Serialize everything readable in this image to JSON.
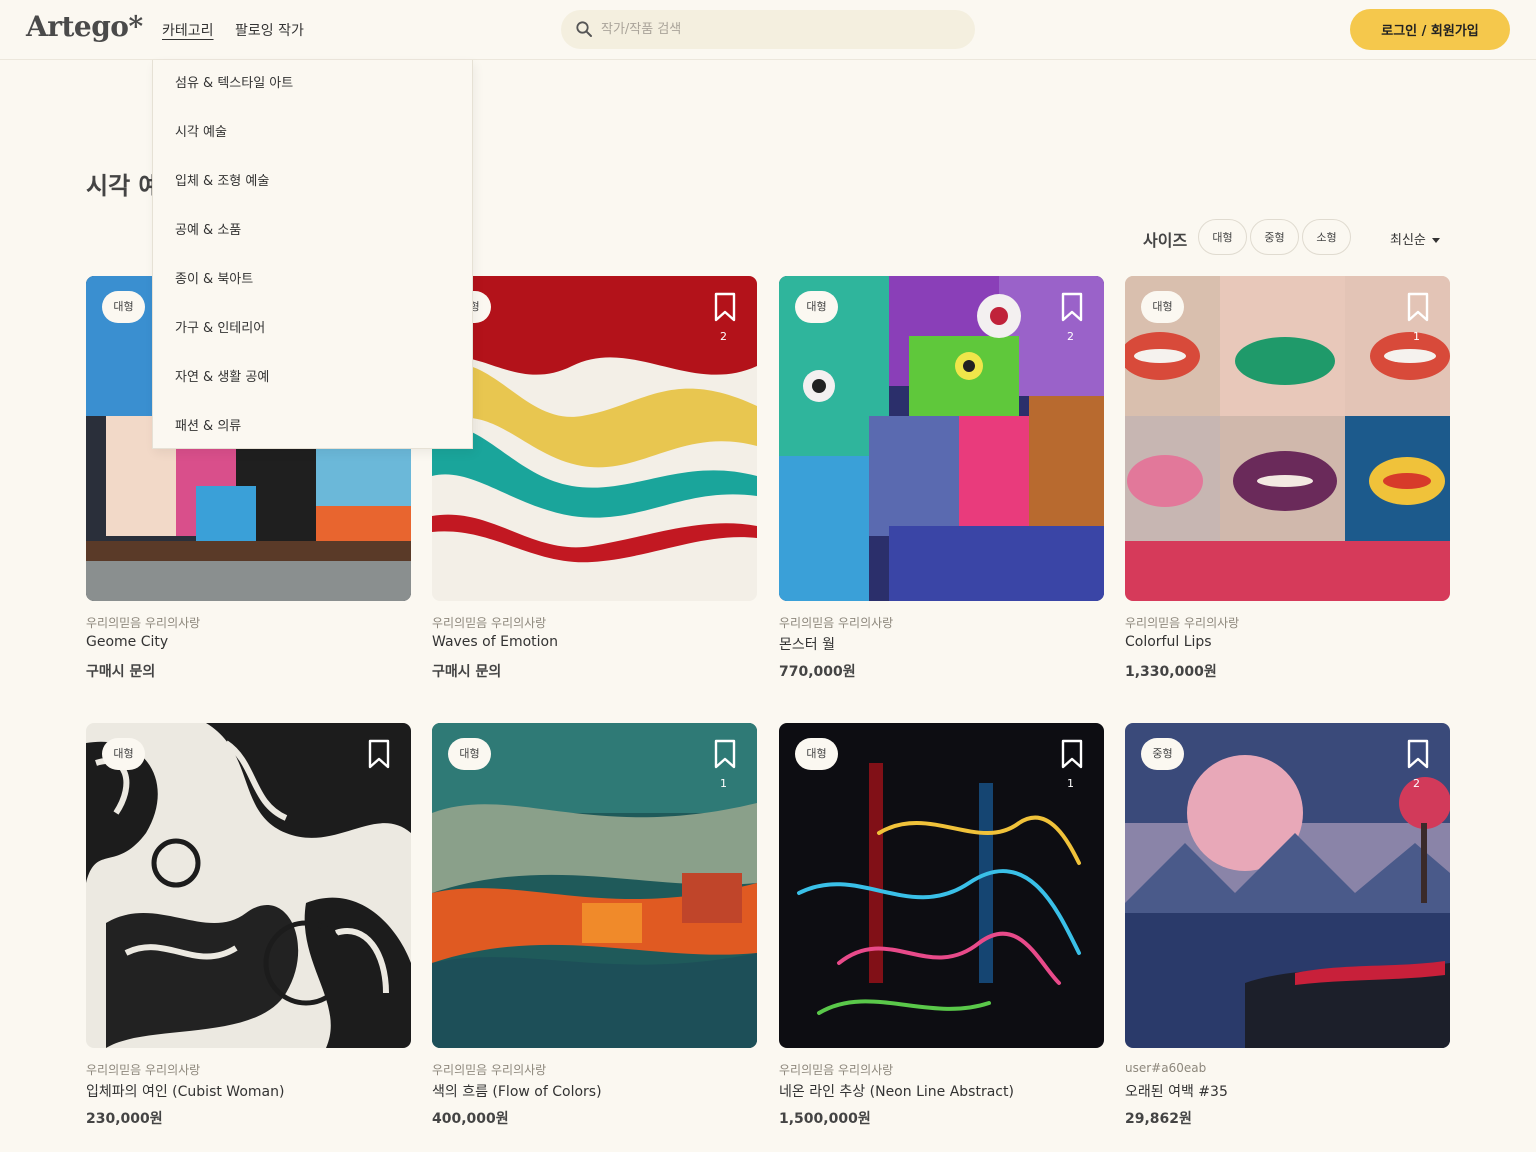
{
  "header": {
    "logo": "Artego*",
    "nav_category": "카테고리",
    "nav_following": "팔로잉 작가",
    "search_placeholder": "작가/작품 검색",
    "login_label": "로그인 / 회원가입"
  },
  "page": {
    "title": "시각 예술"
  },
  "category_menu": {
    "items": [
      "섬유 & 텍스타일 아트",
      "시각 예술",
      "입체 & 조형 예술",
      "공예 & 소품",
      "종이 & 북아트",
      "가구 & 인테리어",
      "자연 & 생활 공예",
      "패션 & 의류"
    ]
  },
  "filters": {
    "size_label": "사이즈",
    "sizes": [
      "대형",
      "중형",
      "소형"
    ],
    "sort_label": "최신순"
  },
  "artworks": [
    {
      "size": "대형",
      "bookmarks": "",
      "artist": "우리의믿음 우리의사랑",
      "title": "Geome City",
      "price": "구매시 문의"
    },
    {
      "size": "대형",
      "bookmarks": "2",
      "artist": "우리의믿음 우리의사랑",
      "title": "Waves of Emotion",
      "price": "구매시 문의"
    },
    {
      "size": "대형",
      "bookmarks": "2",
      "artist": "우리의믿음 우리의사랑",
      "title": "몬스터 월",
      "price": "770,000원"
    },
    {
      "size": "대형",
      "bookmarks": "1",
      "artist": "우리의믿음 우리의사랑",
      "title": "Colorful Lips",
      "price": "1,330,000원"
    },
    {
      "size": "대형",
      "bookmarks": "",
      "artist": "우리의믿음 우리의사랑",
      "title": "입체파의 여인 (Cubist Woman)",
      "price": "230,000원"
    },
    {
      "size": "대형",
      "bookmarks": "1",
      "artist": "우리의믿음 우리의사랑",
      "title": "색의 흐름 (Flow of Colors)",
      "price": "400,000원"
    },
    {
      "size": "대형",
      "bookmarks": "1",
      "artist": "우리의믿음 우리의사랑",
      "title": "네온 라인 추상 (Neon Line Abstract)",
      "price": "1,500,000원"
    },
    {
      "size": "중형",
      "bookmarks": "2",
      "artist": "user#a60eab",
      "title": "오래된 여백 #35",
      "price": "29,862원"
    }
  ],
  "colors": {
    "accent": "#f5c84c",
    "background": "#fbf8f1",
    "search_bg": "#f4efdf"
  }
}
